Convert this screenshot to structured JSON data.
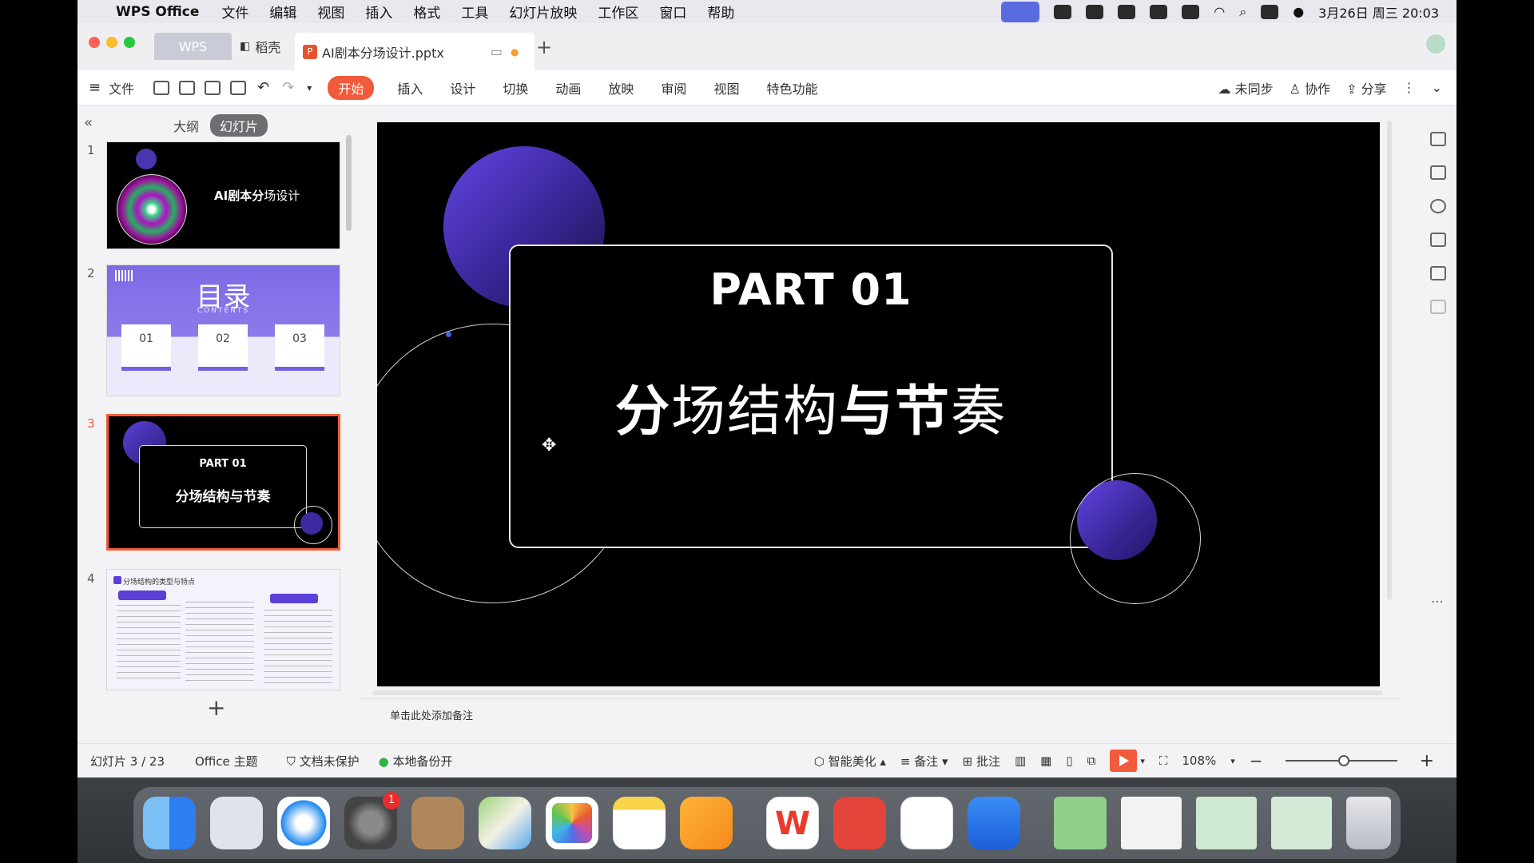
{
  "menubar": {
    "app_name": "WPS Office",
    "items": [
      "文件",
      "编辑",
      "视图",
      "插入",
      "格式",
      "工具",
      "幻灯片放映",
      "工作区",
      "窗口",
      "帮助"
    ],
    "datetime": "3月26日 周三 20:03"
  },
  "tabs": {
    "wps": "WPS",
    "daoke": "稻壳",
    "document": "AI剧本分场设计.pptx"
  },
  "toolbar": {
    "file": "文件",
    "ribbon_tabs": [
      "开始",
      "插入",
      "设计",
      "切换",
      "动画",
      "放映",
      "审阅",
      "视图",
      "特色功能"
    ],
    "sync": "未同步",
    "collab": "协作",
    "share": "分享"
  },
  "leftpanel": {
    "outline": "大纲",
    "slides": "幻灯片",
    "thumbs": [
      {
        "num": "1",
        "title_a": "AI剧",
        "title_b": "本分",
        "title_c": "场设计"
      },
      {
        "num": "2",
        "title": "目录",
        "subtitle": "CONTENTS",
        "cards": [
          "01",
          "02",
          "03"
        ]
      },
      {
        "num": "3",
        "part": "PART 01",
        "title": "分场结构与节奏"
      },
      {
        "num": "4",
        "title": "分场结构的类型与特点"
      }
    ]
  },
  "slide": {
    "part": "PART 01",
    "title_s1": "分",
    "title_s2": "场结构",
    "title_s3": "与节",
    "title_s4": "奏"
  },
  "notes": {
    "placeholder": "单击此处添加备注"
  },
  "status": {
    "slide_count": "幻灯片 3 / 23",
    "theme": "Office 主题",
    "protect": "文档未保护",
    "backup": "本地备份开",
    "beautify": "智能美化",
    "notes": "备注",
    "comment": "批注",
    "zoom": "108%"
  },
  "dock": {
    "apps": [
      "Finder",
      "Launchpad",
      "Safari",
      "System Settings",
      "Contacts",
      "Maps",
      "Photos",
      "Notes",
      "Pages",
      "WPS Office",
      "WPS PDF",
      "Feishu",
      "Live"
    ],
    "settings_badge": "1"
  },
  "colors": {
    "accent": "#f15a3a",
    "purple": "#5b3fd6"
  }
}
